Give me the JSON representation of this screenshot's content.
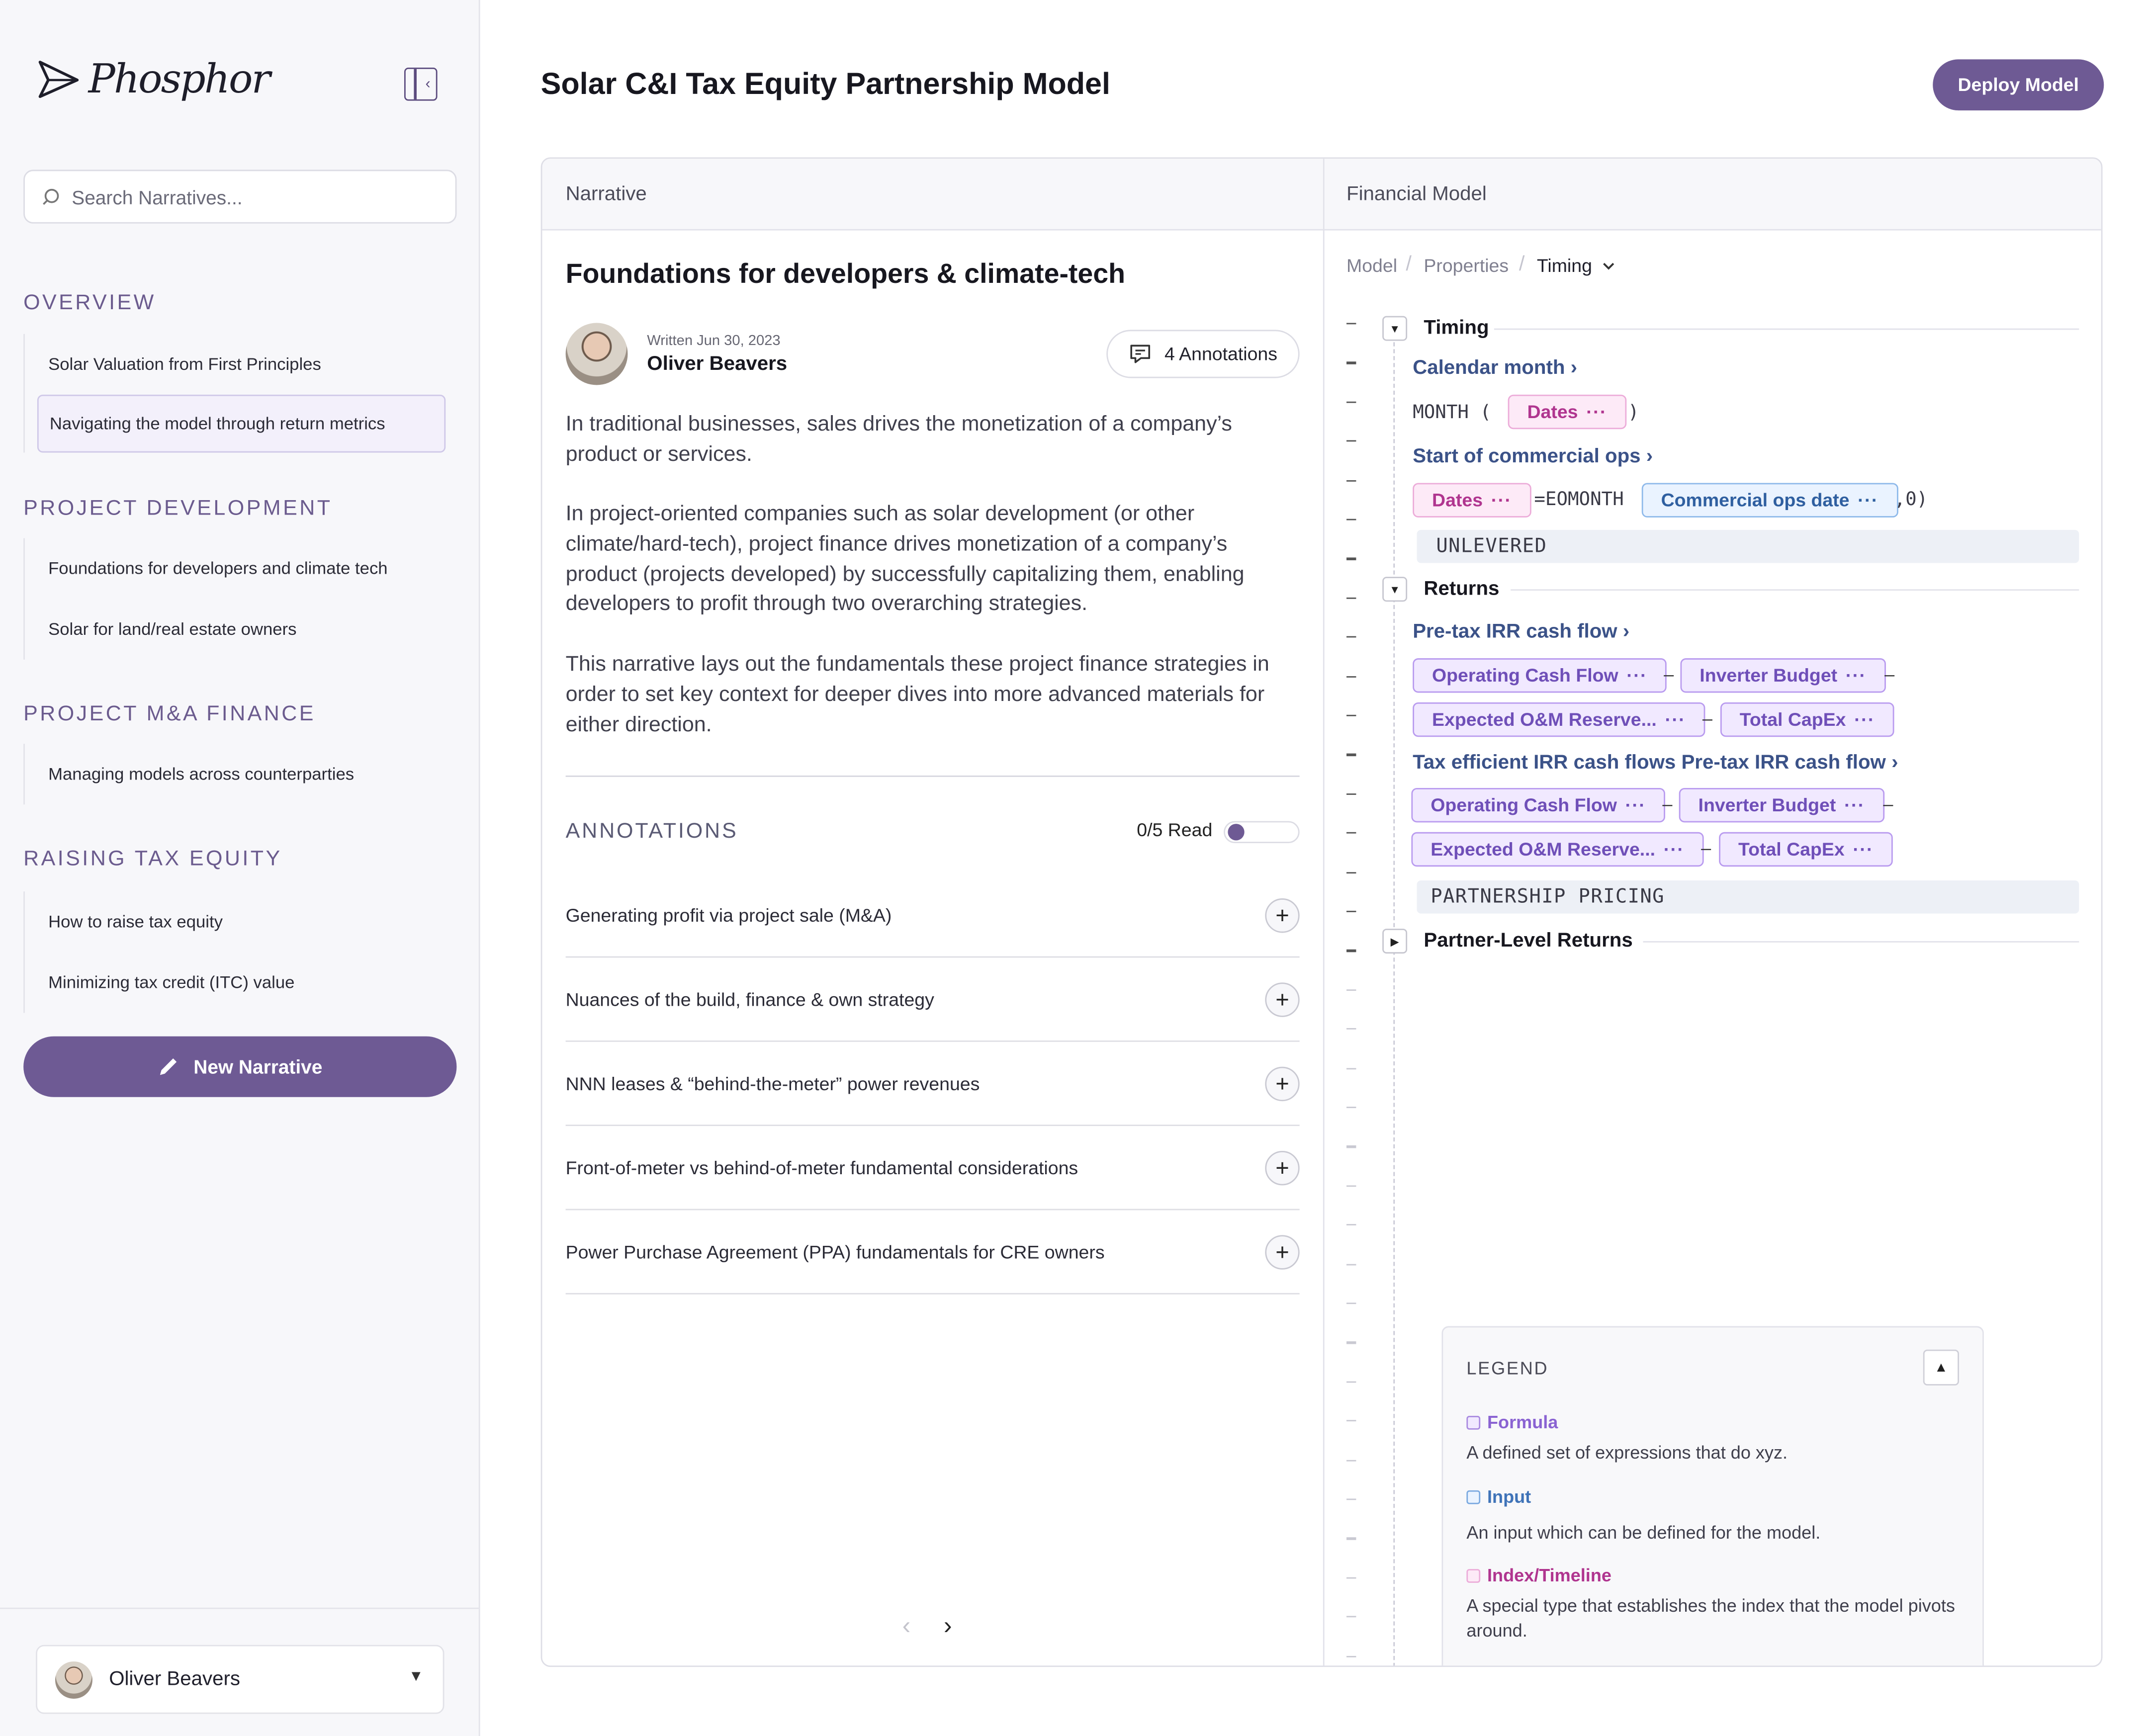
{
  "brand": {
    "name": "Phosphor"
  },
  "sidebar": {
    "search_placeholder": "Search Narratives...",
    "sections": [
      {
        "title": "OVERVIEW",
        "items": [
          "Solar Valuation from First Principles",
          "Navigating the model through return metrics"
        ]
      },
      {
        "title": "PROJECT DEVELOPMENT",
        "items": [
          "Foundations for developers and climate tech",
          "Solar for land/real estate owners"
        ]
      },
      {
        "title": "PROJECT M&A FINANCE",
        "items": [
          "Managing models across counterparties"
        ]
      },
      {
        "title": "RAISING TAX EQUITY",
        "items": [
          "How to raise tax equity",
          "Minimizing tax credit  (ITC) value"
        ]
      }
    ],
    "new_narrative_label": "New Narrative",
    "user_name": "Oliver Beavers"
  },
  "header": {
    "title": "Solar C&I Tax Equity Partnership Model",
    "deploy_label": "Deploy Model"
  },
  "narrative": {
    "panel_label": "Narrative",
    "title": "Foundations for developers & climate-tech",
    "written": "Written Jun 30, 2023",
    "author": "Oliver Beavers",
    "annotations_button": "4 Annotations",
    "paragraphs": [
      "In traditional businesses, sales drives the monetization of a company’s product or services.",
      "In project-oriented companies such as solar development (or other climate/hard-tech), project finance drives monetization of a company’s product (projects developed) by successfully capitalizing them, enabling developers to profit through two overarching strategies.",
      "This narrative lays out the fundamentals these project finance strategies in order to set key context for deeper dives into more advanced materials for either direction."
    ],
    "annotations_title": "ANNOTATIONS",
    "read_count": "0/5 Read",
    "read_fraction": 0,
    "annotations": [
      "Generating profit via project sale (M&A)",
      "Nuances of the build, finance & own strategy",
      "NNN leases & “behind-the-meter” power revenues",
      "Front-of-meter vs behind-of-meter fundamental considerations",
      "Power Purchase Agreement (PPA) fundamentals for CRE owners"
    ]
  },
  "model": {
    "panel_label": "Financial Model",
    "breadcrumb": [
      "Model",
      "Properties",
      "Timing"
    ],
    "timing": {
      "title": "Timing",
      "calendar_month": "Calendar month",
      "month_fn": "MONTH",
      "open_paren": "(",
      "close_paren": ")",
      "dates": "Dates",
      "start_commercial_ops": "Start of commercial ops",
      "equals_eomonth": "=EOMONTH",
      "commercial_ops_date": "Commercial ops date",
      "zero_arg": ",0)"
    },
    "unlevered": "UNLEVERED",
    "returns": {
      "title": "Returns",
      "pretax_irr": "Pre-tax IRR cash flow",
      "tax_efficient_irr": "Tax efficient IRR cash flows Pre-tax IRR cash flow",
      "operating_cash_flow": "Operating Cash Flow",
      "inverter_budget": "Inverter Budget",
      "om_reserve": "Expected O&M Reserve...",
      "total_capex": "Total CapEx",
      "minus": "–"
    },
    "partnership_pricing": "PARTNERSHIP PRICING",
    "partner_level_returns": "Partner-Level Returns",
    "more_dots": "···"
  },
  "legend": {
    "title": "LEGEND",
    "items": [
      {
        "name": "Formula",
        "desc": "A defined set of expressions that do xyz.",
        "color": "#8a63d2"
      },
      {
        "name": "Input",
        "desc": "An input which can be defined for the model.",
        "color": "#3f73b8"
      },
      {
        "name": "Index/Timeline",
        "desc": "A special type that establishes the index that the model pivots around.",
        "color": "#b0358f"
      }
    ]
  },
  "colors": {
    "accent": "#6e5a94",
    "link": "#3b5288"
  }
}
